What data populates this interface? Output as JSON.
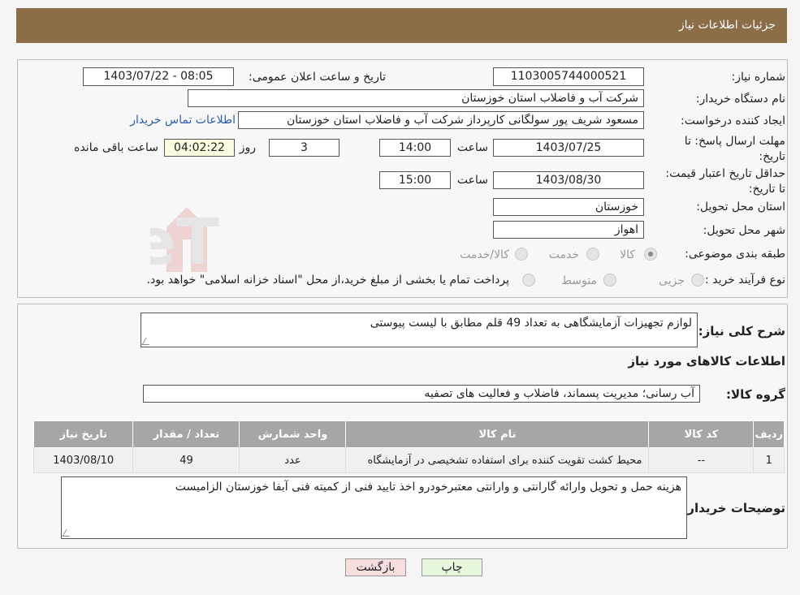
{
  "header": {
    "title": "جزئیات اطلاعات نیاز"
  },
  "need_info": {
    "need_number_label": "شماره نیاز:",
    "need_number": "1103005744000521",
    "announce_label": "تاریخ و ساعت اعلان عمومی:",
    "announce_value": "1403/07/22 - 08:05",
    "buyer_org_label": "نام دستگاه خریدار:",
    "buyer_org": "شرکت آب و فاضلاب استان خوزستان",
    "requester_label": "ایجاد کننده درخواست:",
    "requester": "مسعود شریف پور سولگانی کارپرداز شرکت آب و فاضلاب استان خوزستان",
    "contact_link": "اطلاعات تماس خریدار",
    "reply_deadline_label": "مهلت ارسال پاسخ: تا تاریخ:",
    "reply_date": "1403/07/25",
    "time_label": "ساعت",
    "reply_time": "14:00",
    "days_value": "3",
    "days_label": "روز و",
    "remaining_time": "04:02:22",
    "remaining_label": "ساعت باقی مانده",
    "price_validity_label": "حداقل تاریخ اعتبار قیمت: تا تاریخ:",
    "price_date": "1403/08/30",
    "price_time": "15:00",
    "province_label": "استان محل تحویل:",
    "province": "خوزستان",
    "city_label": "شهر محل تحویل:",
    "city": "اهواز",
    "category_label": "طبقه بندی موضوعی:",
    "category_options": [
      "کالا",
      "خدمت",
      "کالا/خدمت"
    ],
    "process_label": "نوع فرآیند خرید :",
    "process_options": [
      "جزیی",
      "متوسط"
    ],
    "payment_note": "پرداخت تمام یا بخشی از مبلغ خرید،از محل \"اسناد خزانه اسلامی\" خواهد بود."
  },
  "description": {
    "label": "شرح کلی نیاز:",
    "value": "لوازم تجهیزات آزمایشگاهی  به تعداد 49 قلم مطابق با لیست پیوستی"
  },
  "goods": {
    "section_title": "اطلاعات کالاهای مورد نیاز",
    "group_label": "گروه کالا:",
    "group_value": "آب رسانی؛ مدیریت پسماند، فاضلاب و فعالیت های تصفیه",
    "columns": [
      "ردیف",
      "کد کالا",
      "نام کالا",
      "واحد شمارش",
      "تعداد / مقدار",
      "تاریخ نیاز"
    ],
    "rows": [
      [
        "1",
        "--",
        "محیط کشت تقویت کننده برای استفاده تشخیصی در آزمایشگاه",
        "عدد",
        "49",
        "1403/08/10"
      ]
    ]
  },
  "buyer_notes": {
    "label": "توضیحات خریدار:",
    "value": "هزینه حمل و تحویل وارائه گارانتی و وارانتی معتبرخودرو اخذ تایید فنی از کمیته فنی آبفا خوزستان الزامیست"
  },
  "buttons": {
    "print": "چاپ",
    "back": "بازگشت"
  },
  "watermark": {
    "text": "AriaTender.neT"
  },
  "colors": {
    "header": "#8b6e48",
    "link": "#2a5db0",
    "back_button": "#f7dede",
    "print_button": "#e6f7de"
  }
}
